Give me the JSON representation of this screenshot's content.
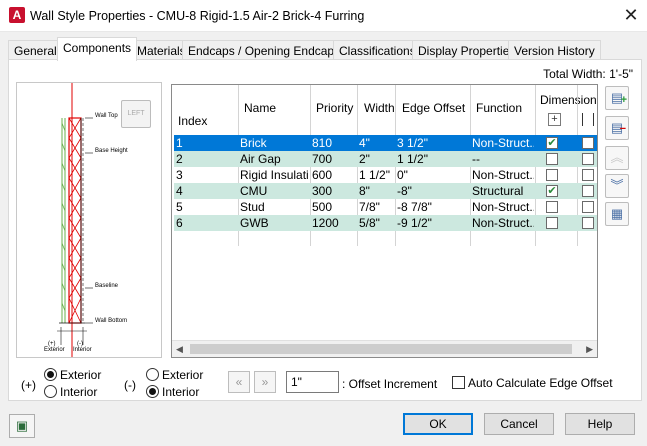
{
  "window": {
    "title": "Wall Style Properties - CMU-8 Rigid-1.5 Air-2 Brick-4 Furring",
    "app_icon": "A",
    "close_glyph": "✕"
  },
  "tabs": [
    "General",
    "Components",
    "Materials",
    "Endcaps / Opening Endcaps",
    "Classifications",
    "Display Properties",
    "Version History"
  ],
  "active_tab": "Components",
  "total_width": "Total Width: 1'-5\"",
  "preview": {
    "left_button": "LEFT",
    "labels": {
      "wall_top": "Wall Top",
      "base_height": "Base Height",
      "baseline": "Baseline",
      "wall_bottom": "Wall Bottom",
      "exterior": "Exterior",
      "interior": "Interior",
      "plus": "(+)",
      "minus": "(-)"
    }
  },
  "table": {
    "headers": {
      "index": "Index",
      "name": "Name",
      "priority": "Priority",
      "width": "Width",
      "edge_offset": "Edge Offset",
      "function": "Function",
      "dimension": "Dimension"
    },
    "rows": [
      {
        "index": "1",
        "name": "Brick",
        "priority": "810",
        "width": "4\"",
        "edge_offset": "3 1/2\"",
        "function": "Non-Struct...",
        "dim": true
      },
      {
        "index": "2",
        "name": "Air Gap",
        "priority": "700",
        "width": "2\"",
        "edge_offset": "1 1/2\"",
        "function": "--",
        "dim": false
      },
      {
        "index": "3",
        "name": "Rigid Insulati...",
        "priority": "600",
        "width": "1 1/2\"",
        "edge_offset": "0\"",
        "function": "Non-Struct...",
        "dim": false
      },
      {
        "index": "4",
        "name": "CMU",
        "priority": "300",
        "width": "8\"",
        "edge_offset": "-8\"",
        "function": "Structural",
        "dim": true
      },
      {
        "index": "5",
        "name": "Stud",
        "priority": "500",
        "width": "7/8\"",
        "edge_offset": "-8 7/8\"",
        "function": "Non-Struct...",
        "dim": false
      },
      {
        "index": "6",
        "name": "GWB",
        "priority": "1200",
        "width": "5/8\"",
        "edge_offset": "-9 1/2\"",
        "function": "Non-Struct...",
        "dim": false
      }
    ],
    "selected_row": 1
  },
  "positive_side": {
    "symbol": "(+)",
    "options": [
      "Exterior",
      "Interior"
    ],
    "selected": "Exterior"
  },
  "negative_side": {
    "symbol": "(-)",
    "options": [
      "Exterior",
      "Interior"
    ],
    "selected": "Interior"
  },
  "offset": {
    "value": "1\"",
    "label": ": Offset Increment",
    "decrement_icon": "«",
    "increment_icon": "»"
  },
  "auto_calc": {
    "label": "Auto Calculate Edge Offset",
    "checked": false
  },
  "buttons": {
    "ok": "OK",
    "cancel": "Cancel",
    "help": "Help"
  },
  "colors": {
    "selection": "#0078d7",
    "alt_row": "#cce8df",
    "accent_red": "#c8102e"
  }
}
